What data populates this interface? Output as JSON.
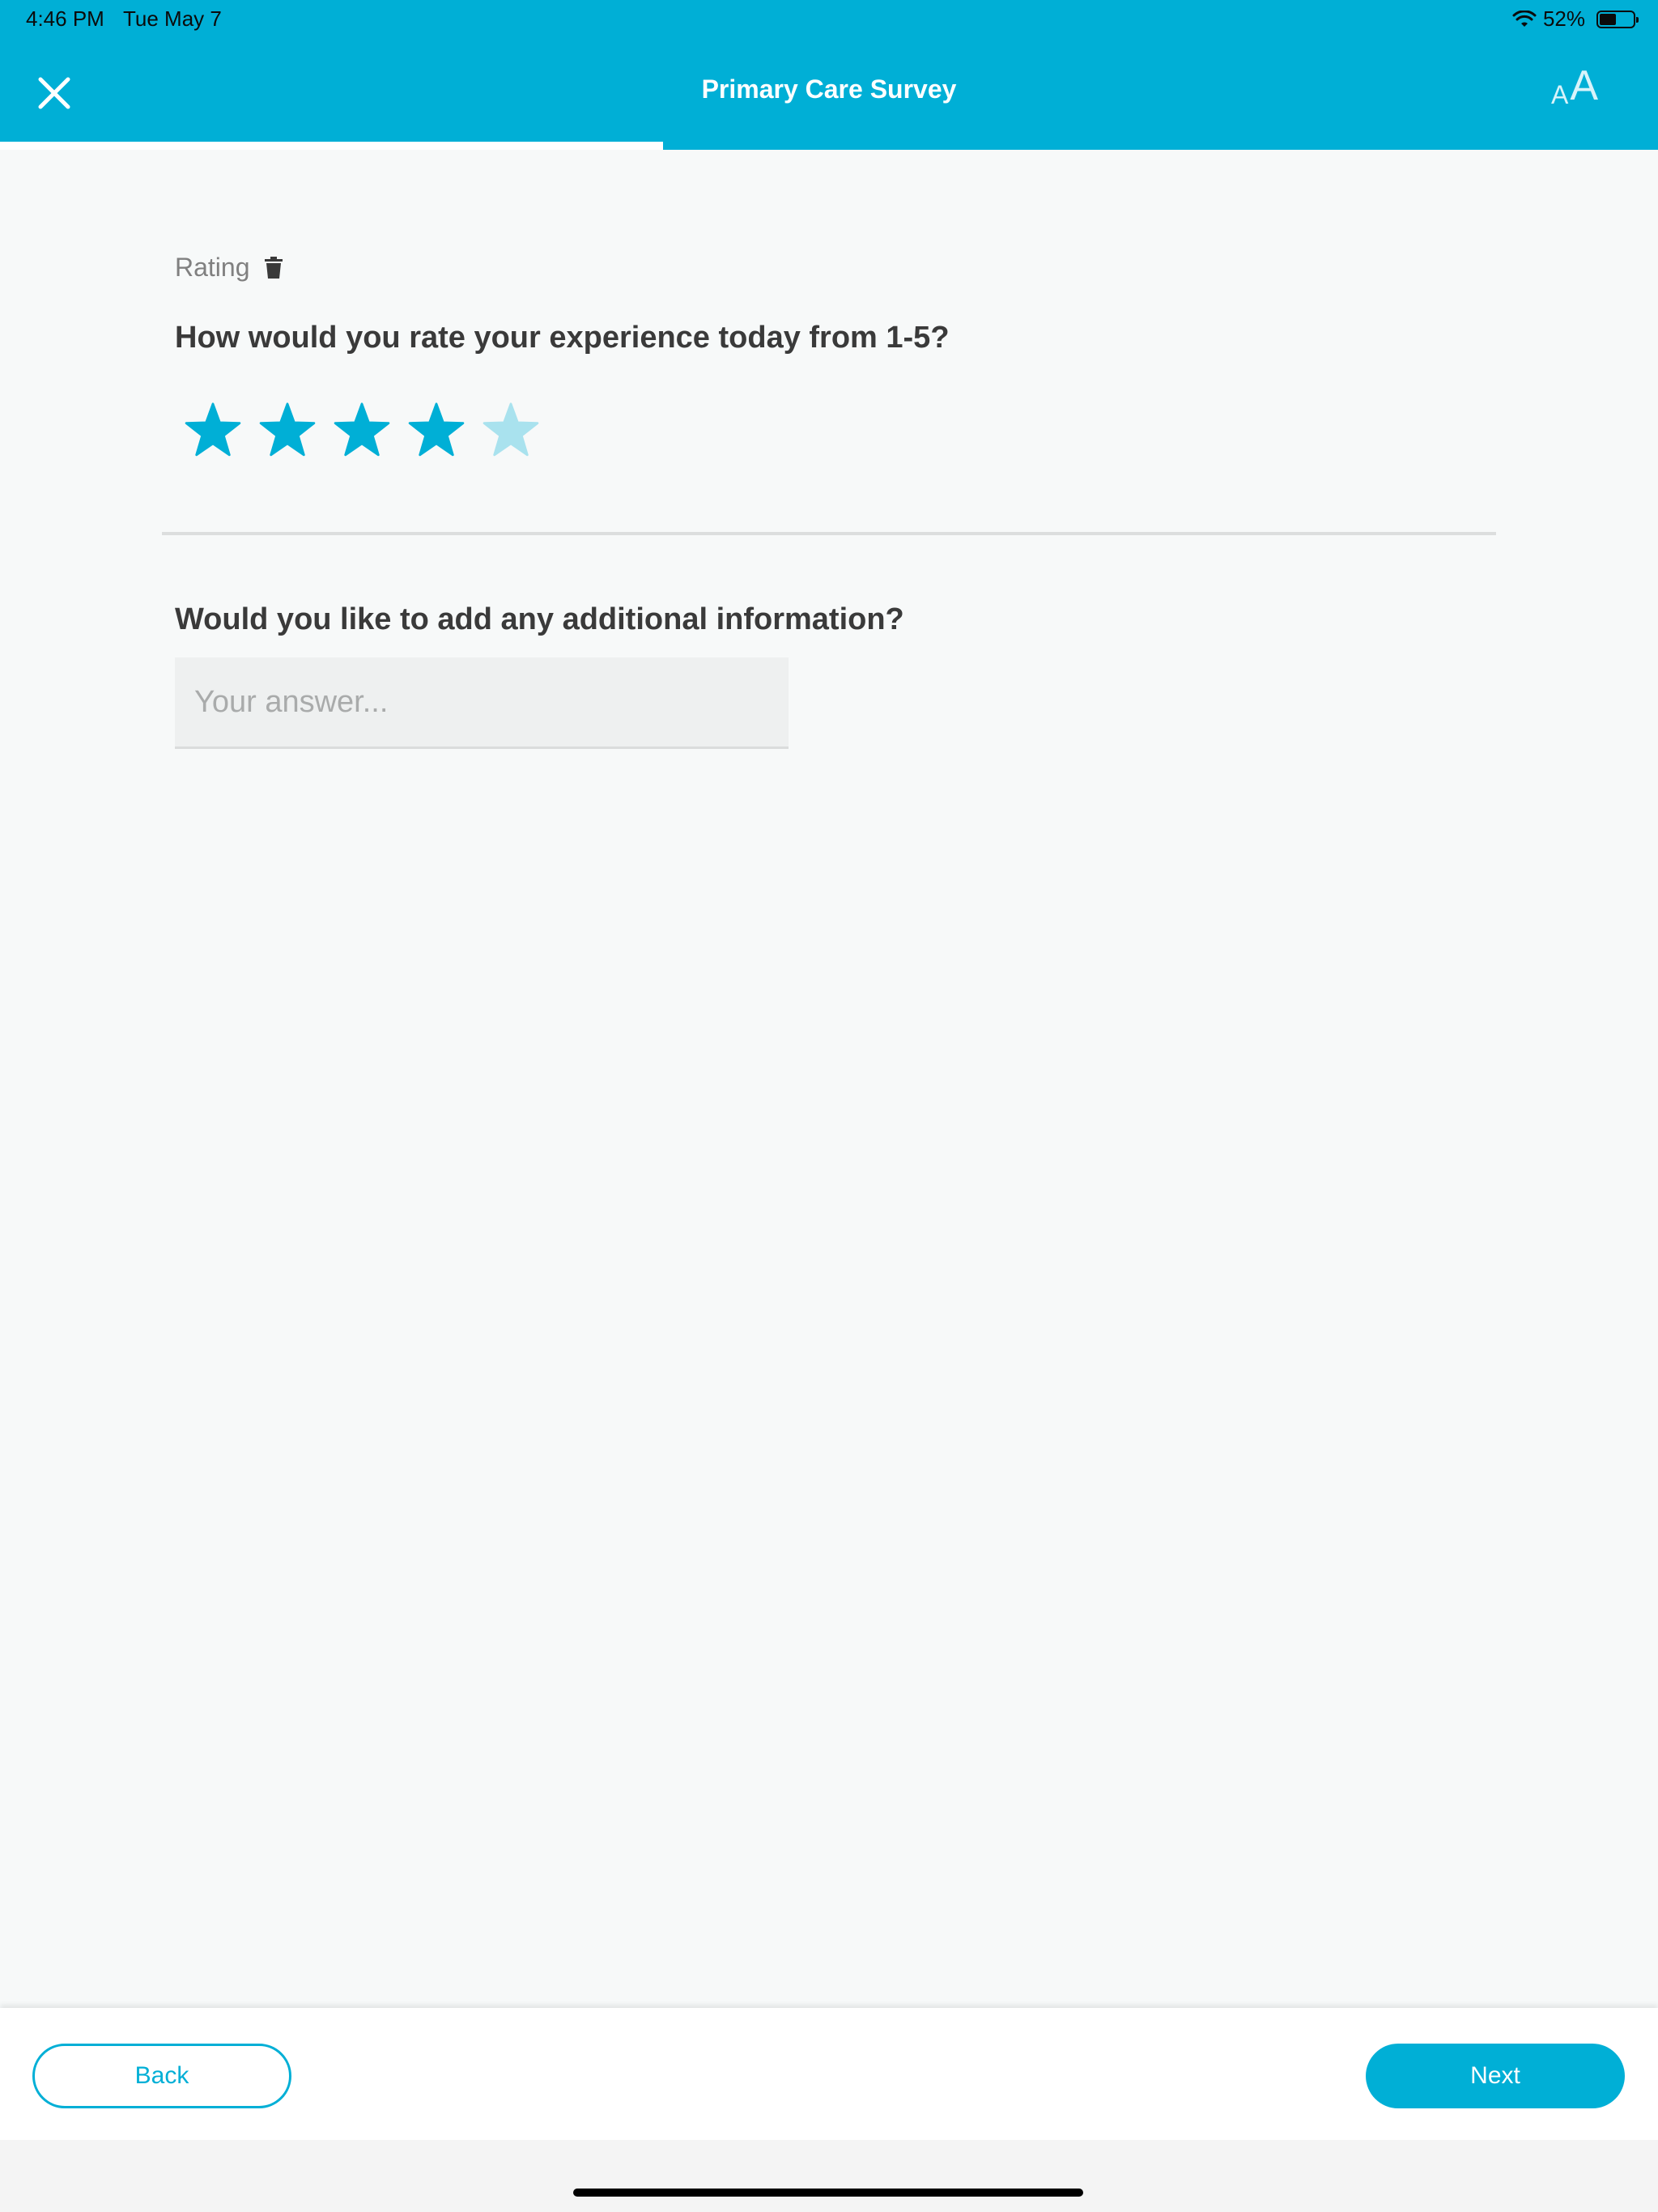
{
  "status_bar": {
    "time": "4:46 PM",
    "date": "Tue May 7",
    "battery": "52%"
  },
  "header": {
    "title": "Primary Care Survey",
    "text_size_small": "A",
    "text_size_large": "A",
    "progress_fraction": 0.4
  },
  "questions": {
    "rating": {
      "label": "Rating",
      "prompt": "How would you rate your experience today from 1-5?",
      "value": 4,
      "max": 5
    },
    "additional": {
      "prompt": "Would you like to add any additional information?",
      "placeholder": "Your answer...",
      "value": ""
    }
  },
  "footer": {
    "back_label": "Back",
    "next_label": "Next"
  },
  "colors": {
    "accent": "#00afd6",
    "star_active": "#00afd6",
    "star_inactive": "#a9e2ee"
  },
  "icons": [
    "close-icon",
    "text-size-icon",
    "trash-icon",
    "star-icon",
    "wifi-icon",
    "battery-icon"
  ]
}
